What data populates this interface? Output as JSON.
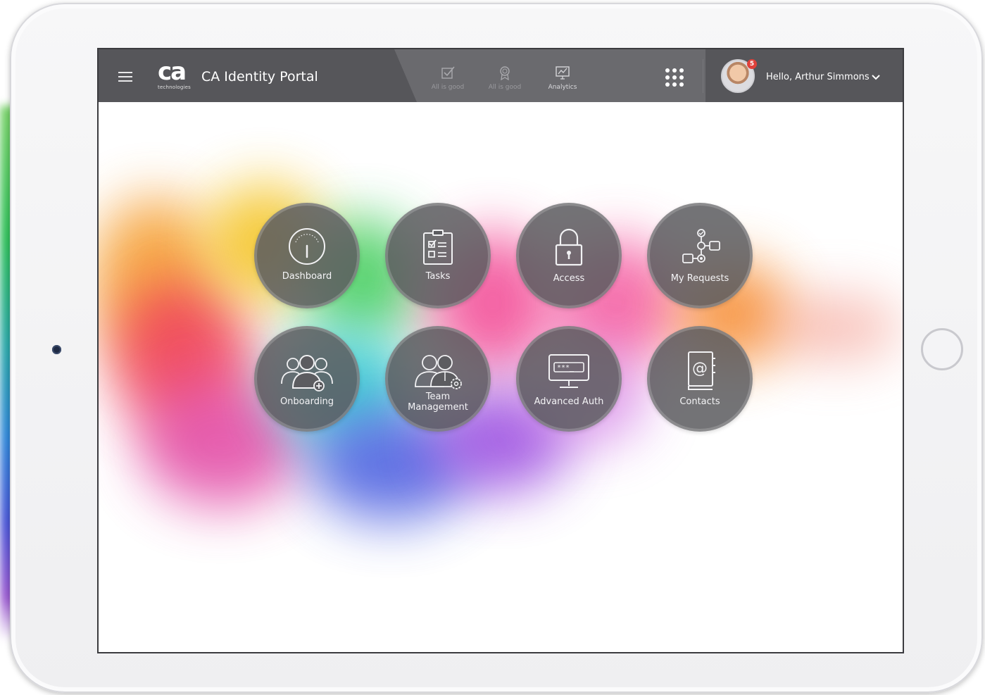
{
  "header": {
    "logo_mark": "ca",
    "logo_subtext": "technologies",
    "title": "CA Identity Portal",
    "tabs": [
      {
        "label": "All is good",
        "icon": "check-square-icon"
      },
      {
        "label": "All is good",
        "icon": "badge-icon"
      },
      {
        "label": "Analytics",
        "icon": "analytics-chart-icon"
      }
    ],
    "notification_count": "5",
    "greeting": "Hello, Arthur Simmons"
  },
  "tiles": [
    {
      "label": "Dashboard",
      "icon": "gauge-icon"
    },
    {
      "label": "Tasks",
      "icon": "checklist-icon"
    },
    {
      "label": "Access",
      "icon": "padlock-icon"
    },
    {
      "label": "My Requests",
      "icon": "workflow-icon"
    },
    {
      "label": "Onboarding",
      "icon": "users-add-icon"
    },
    {
      "label": "Team",
      "label2": "Management",
      "icon": "team-settings-icon"
    },
    {
      "label": "Advanced Auth",
      "icon": "password-monitor-icon"
    },
    {
      "label": "Contacts",
      "icon": "address-book-icon"
    }
  ],
  "colors": {
    "topbar": "#56565a",
    "tile_fill": "#5c5c60",
    "badge": "#e0413a"
  }
}
